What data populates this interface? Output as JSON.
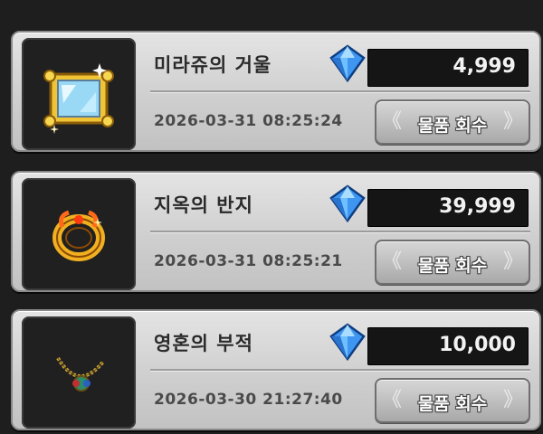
{
  "items": [
    {
      "name": "미라쥬의 거울",
      "price": "4,999",
      "date": "2026-03-31 08:25:24",
      "button_label": "물품 회수",
      "icon": "golden-mirror-icon"
    },
    {
      "name": "지옥의 반지",
      "price": "39,999",
      "date": "2026-03-31 08:25:21",
      "button_label": "물품 회수",
      "icon": "golden-ring-icon"
    },
    {
      "name": "영혼의 부적",
      "price": "10,000",
      "date": "2026-03-30 21:27:40",
      "button_label": "물품 회수",
      "icon": "amulet-necklace-icon"
    }
  ],
  "currency_icon": "blue-diamond-icon",
  "colors": {
    "card": "#d6d6d6",
    "price_box": "#151515",
    "gem": "#4aa3ff",
    "gold": "#e8b829"
  }
}
